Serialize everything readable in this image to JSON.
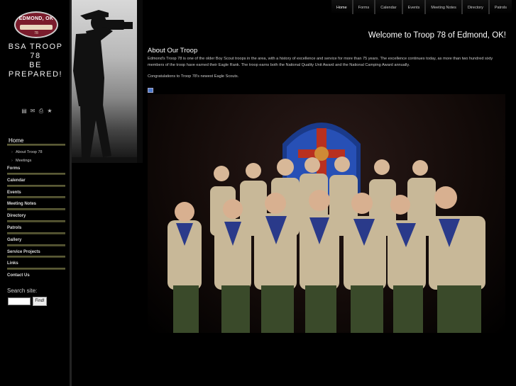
{
  "logo": {
    "top_text": "EDMOND, OK",
    "sub_text": "78"
  },
  "site": {
    "line1": "BSA TROOP",
    "line2": "78",
    "line3": "BE",
    "line4": "PREPARED!"
  },
  "tools": [
    "print-view-icon",
    "email-icon",
    "print-icon",
    "bookmark-icon"
  ],
  "topnav": [
    "Home",
    "Forms",
    "Calendar",
    "Events",
    "Meeting Notes",
    "Directory",
    "Patrols"
  ],
  "sidenav": {
    "home": "Home",
    "sub": [
      "About Troop 78",
      "Meetings"
    ],
    "items": [
      "Forms",
      "Calendar",
      "Events",
      "Meeting Notes",
      "Directory",
      "Patrols",
      "Gallery",
      "Service Projects",
      "Links",
      "Contact Us"
    ]
  },
  "search": {
    "label": "Search site:",
    "button": "Find!",
    "value": ""
  },
  "main": {
    "welcome": "Welcome to Troop 78 of Edmond, OK!",
    "about_title": "About Our Troop",
    "about_body": "Edmond's Troop 78 is one of the older Boy Scout troops in the area, with a history of excellence and service for more than 75 years. The excellence continues today, as more than two hundred sixty members of the troop have earned their Eagle Rank. The troop earns both the National Quality Unit Award and the National Camping Award annually.",
    "congrats": "Congratulations to Troop 78's newest Eagle Scouts."
  },
  "colors": {
    "background": "#000000",
    "nav_bar": "#5a5a30",
    "logo": "#7a1c2c",
    "uniform": "#c8b898",
    "pants": "#3a4a2a"
  }
}
